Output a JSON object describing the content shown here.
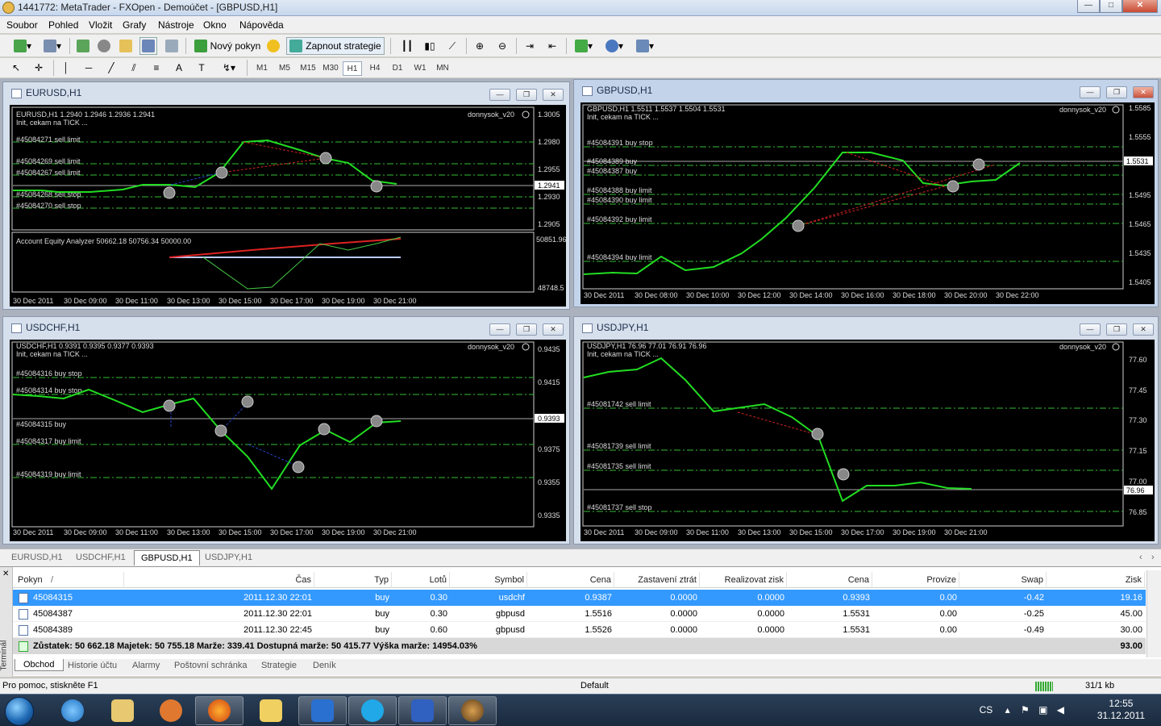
{
  "window": {
    "title": "1441772: MetaTrader - FXOpen - Demoúčet - [GBPUSD,H1]"
  },
  "menu": [
    "Soubor",
    "Pohled",
    "Vložit",
    "Grafy",
    "Nástroje",
    "Okno",
    "Nápověda"
  ],
  "toolbar": {
    "new_order": "Nový pokyn",
    "strategies": "Zapnout strategie"
  },
  "timeframes": [
    "M1",
    "M5",
    "M15",
    "M30",
    "H1",
    "H4",
    "D1",
    "W1",
    "MN"
  ],
  "active_timeframe": "H1",
  "charts": {
    "eurusd": {
      "title": "EURUSD,H1",
      "info": "EURUSD,H1  1.2940 1.2946 1.2936 1.2941",
      "status": "Init, cekam na TICK ...",
      "ea": "donnysok_v20",
      "prices": [
        "1.3005",
        "1.2980",
        "1.2955",
        "1.2930",
        "1.2905"
      ],
      "current_price": "1.2941",
      "orders": [
        "#45084271 sell limit",
        "#45084269 sell limit",
        "#45084267 sell limit",
        "#45084268 sell stop",
        "#45084270 sell stop"
      ],
      "indicator": "Account Equity Analyzer 50662.18 50756.34 50000.00",
      "ind_hi": "50851.96",
      "ind_lo": "48748.5",
      "times": [
        "30 Dec 2011",
        "30 Dec 09:00",
        "30 Dec 11:00",
        "30 Dec 13:00",
        "30 Dec 15:00",
        "30 Dec 17:00",
        "30 Dec 19:00",
        "30 Dec 21:00"
      ]
    },
    "gbpusd": {
      "title": "GBPUSD,H1",
      "info": "GBPUSD,H1  1.5511 1.5537 1.5504 1.5531",
      "status": "Init, cekam na TICK ...",
      "ea": "donnysok_v20",
      "prices": [
        "1.5585",
        "1.5555",
        "1.5525",
        "1.5495",
        "1.5465",
        "1.5435",
        "1.5405"
      ],
      "current_price": "1.5531",
      "orders": [
        "#45084391 buy stop",
        "#45084389 buy",
        "#45084387 buy",
        "#45084388 buy limit",
        "#45084390 buy limit",
        "#45084392 buy limit",
        "#45084394 buy limit"
      ],
      "times": [
        "30 Dec 2011",
        "30 Dec 08:00",
        "30 Dec 10:00",
        "30 Dec 12:00",
        "30 Dec 14:00",
        "30 Dec 16:00",
        "30 Dec 18:00",
        "30 Dec 20:00",
        "30 Dec 22:00"
      ]
    },
    "usdchf": {
      "title": "USDCHF,H1",
      "info": "USDCHF,H1  0.9391 0.9395 0.9377 0.9393",
      "status": "Init, cekam na TICK ...",
      "ea": "donnysok_v20",
      "prices": [
        "0.9435",
        "0.9415",
        "0.9395",
        "0.9375",
        "0.9355",
        "0.9335"
      ],
      "current_price": "0.9393",
      "orders": [
        "#45084316 buy stop",
        "#45084314 buy stop",
        "#45084315 buy",
        "#45084317 buy limit",
        "#45084319 buy limit"
      ],
      "times": [
        "30 Dec 2011",
        "30 Dec 09:00",
        "30 Dec 11:00",
        "30 Dec 13:00",
        "30 Dec 15:00",
        "30 Dec 17:00",
        "30 Dec 19:00",
        "30 Dec 21:00"
      ]
    },
    "usdjpy": {
      "title": "USDJPY,H1",
      "info": "USDJPY,H1  76.96 77.01 76.91 76.96",
      "status": "Init, cekam na TICK ...",
      "ea": "donnysok_v20",
      "prices": [
        "77.60",
        "77.45",
        "77.30",
        "77.15",
        "77.00",
        "76.85"
      ],
      "current_price": "76.96",
      "orders": [
        "#45081742 sell limit",
        "#45081739 sell limit",
        "#45081735 sell limit",
        "#45081737 sell stop"
      ],
      "times": [
        "30 Dec 2011",
        "30 Dec 09:00",
        "30 Dec 11:00",
        "30 Dec 13:00",
        "30 Dec 15:00",
        "30 Dec 17:00",
        "30 Dec 19:00",
        "30 Dec 21:00"
      ]
    }
  },
  "chart_tabs": [
    "EURUSD,H1",
    "USDCHF,H1",
    "GBPUSD,H1",
    "USDJPY,H1"
  ],
  "active_chart_tab": "GBPUSD,H1",
  "terminal": {
    "columns": [
      "Pokyn",
      "/",
      "Čas",
      "Typ",
      "Lotů",
      "Symbol",
      "Cena",
      "Zastavení ztrát",
      "Realizovat zisk",
      "Cena",
      "Provize",
      "Swap",
      "Zisk"
    ],
    "rows": [
      [
        "45084315",
        "2011.12.30 22:01",
        "buy",
        "0.30",
        "usdchf",
        "0.9387",
        "0.0000",
        "0.0000",
        "0.9393",
        "0.00",
        "-0.42",
        "19.16"
      ],
      [
        "45084387",
        "2011.12.30 22:01",
        "buy",
        "0.30",
        "gbpusd",
        "1.5516",
        "0.0000",
        "0.0000",
        "1.5531",
        "0.00",
        "-0.25",
        "45.00"
      ],
      [
        "45084389",
        "2011.12.30 22:45",
        "buy",
        "0.60",
        "gbpusd",
        "1.5526",
        "0.0000",
        "0.0000",
        "1.5531",
        "0.00",
        "-0.49",
        "30.00"
      ]
    ],
    "summary": "Zůstatek: 50 662.18  Majetek: 50 755.18  Marže: 339.41  Dostupná marže: 50 415.77  Výška marže: 14954.03%",
    "summary_profit": "93.00",
    "side_label": "Terminál",
    "tabs": [
      "Obchod",
      "Historie účtu",
      "Alarmy",
      "Poštovní schránka",
      "Strategie",
      "Deník"
    ],
    "active_tab": "Obchod"
  },
  "statusbar": {
    "help": "Pro pomoc, stiskněte F1",
    "profile": "Default",
    "traffic": "31/1 kb"
  },
  "taskbar": {
    "lang": "CS",
    "time": "12:55",
    "date": "31.12.2011"
  },
  "colors": {
    "chart_bg": "#000000",
    "price_line": "#22dd22",
    "order_line": "#33bb33",
    "accent": "#3399ff"
  }
}
